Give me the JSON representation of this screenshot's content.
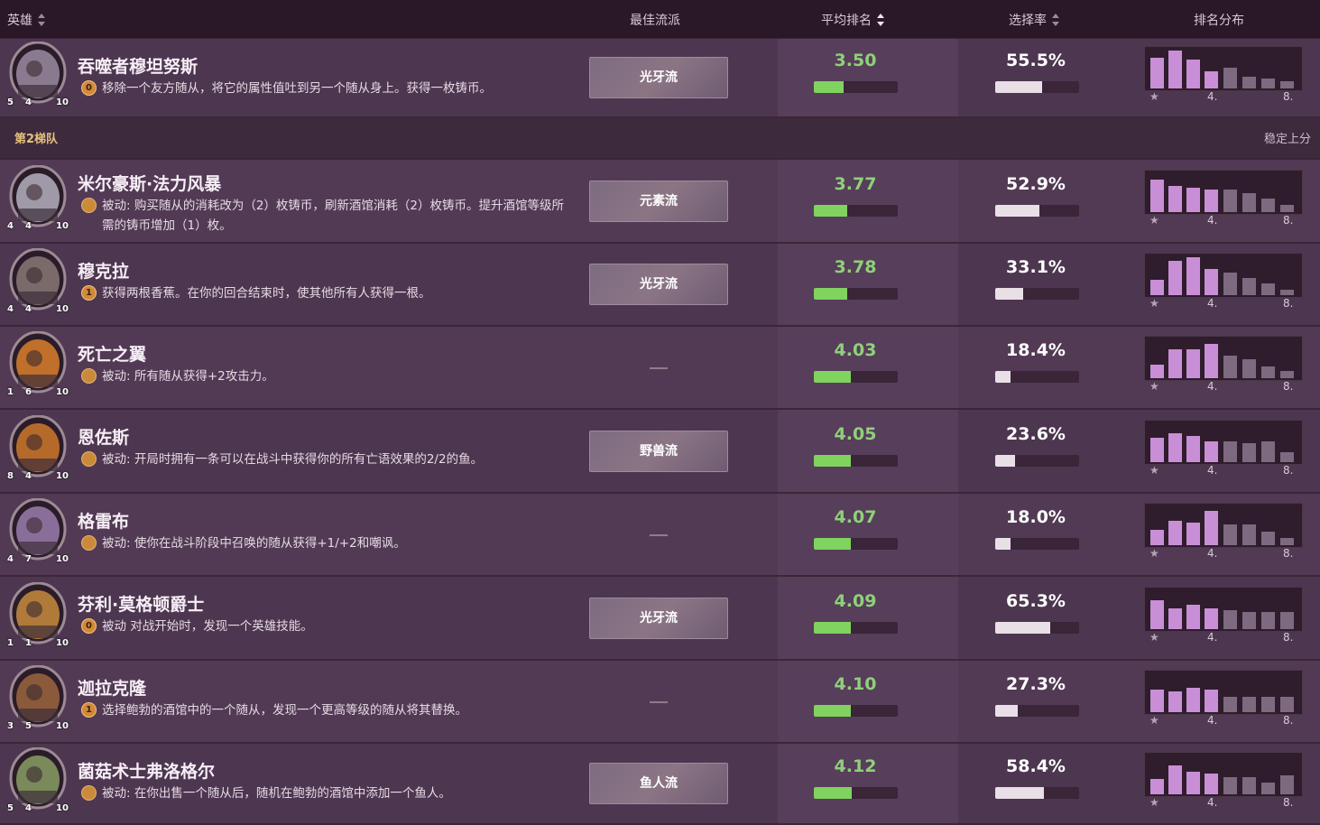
{
  "header": {
    "hero": "英雄",
    "best_comp": "最佳流派",
    "avg_rank": "平均排名",
    "pick_rate": "选择率",
    "distribution": "排名分布"
  },
  "tier2": {
    "label": "第2梯队",
    "note": "稳定上分"
  },
  "dist_labels": {
    "first": "★",
    "mid": "4.",
    "last": "8."
  },
  "colors": {
    "avg_fill": "#7fd35e",
    "pick_fill": "#e8e0e6",
    "dist_top": "#c98fd6",
    "dist_bottom": "#7e6a80"
  },
  "heroes": [
    {
      "name": "吞噬者穆坦努斯",
      "cost": "0",
      "power": "移除一个友方随从，将它的属性值吐到另一个随从身上。获得一枚铸币。",
      "comp": "光牙流",
      "avg": "3.50",
      "avg_pct": 0.35,
      "pick": "55.5%",
      "pick_pct": 0.555,
      "atk": "5",
      "hp": "4",
      "armor": "10",
      "dist": [
        0.8,
        1.0,
        0.75,
        0.45,
        0.55,
        0.3,
        0.25,
        0.2
      ]
    },
    {
      "name": "米尔豪斯·法力风暴",
      "cost": "",
      "power": "被动: 购买随从的消耗改为（2）枚铸币，刷新酒馆消耗（2）枚铸币。提升酒馆等级所需的铸币增加（1）枚。",
      "comp": "元素流",
      "avg": "3.77",
      "avg_pct": 0.4,
      "pick": "52.9%",
      "pick_pct": 0.529,
      "atk": "4",
      "hp": "4",
      "armor": "10",
      "dist": [
        0.85,
        0.7,
        0.65,
        0.6,
        0.6,
        0.5,
        0.35,
        0.2
      ]
    },
    {
      "name": "穆克拉",
      "cost": "1",
      "power": "获得两根香蕉。在你的回合结束时，使其他所有人获得一根。",
      "comp": "光牙流",
      "avg": "3.78",
      "avg_pct": 0.4,
      "pick": "33.1%",
      "pick_pct": 0.331,
      "atk": "4",
      "hp": "4",
      "armor": "10",
      "dist": [
        0.4,
        0.9,
        1.0,
        0.7,
        0.6,
        0.45,
        0.3,
        0.15
      ]
    },
    {
      "name": "死亡之翼",
      "cost": "",
      "power": "被动: 所有随从获得+2攻击力。",
      "comp": "",
      "avg": "4.03",
      "avg_pct": 0.44,
      "pick": "18.4%",
      "pick_pct": 0.184,
      "atk": "1",
      "hp": "6",
      "armor": "10",
      "dist": [
        0.35,
        0.75,
        0.75,
        0.9,
        0.6,
        0.5,
        0.3,
        0.2
      ]
    },
    {
      "name": "恩佐斯",
      "cost": "",
      "power": "被动: 开局时拥有一条可以在战斗中获得你的所有亡语效果的2/2的鱼。",
      "comp": "野兽流",
      "avg": "4.05",
      "avg_pct": 0.44,
      "pick": "23.6%",
      "pick_pct": 0.236,
      "atk": "8",
      "hp": "4",
      "armor": "10",
      "dist": [
        0.65,
        0.75,
        0.7,
        0.55,
        0.55,
        0.5,
        0.55,
        0.25
      ]
    },
    {
      "name": "格雷布",
      "cost": "",
      "power": "被动: 使你在战斗阶段中召唤的随从获得+1/+2和嘲讽。",
      "comp": "",
      "avg": "4.07",
      "avg_pct": 0.44,
      "pick": "18.0%",
      "pick_pct": 0.18,
      "atk": "4",
      "hp": "7",
      "armor": "10",
      "dist": [
        0.4,
        0.65,
        0.6,
        0.9,
        0.55,
        0.55,
        0.35,
        0.2
      ]
    },
    {
      "name": "芬利·莫格顿爵士",
      "cost": "0",
      "power": "被动 对战开始时，发现一个英雄技能。",
      "comp": "光牙流",
      "avg": "4.09",
      "avg_pct": 0.44,
      "pick": "65.3%",
      "pick_pct": 0.653,
      "atk": "1",
      "hp": "1",
      "armor": "10",
      "dist": [
        0.75,
        0.55,
        0.65,
        0.55,
        0.5,
        0.45,
        0.45,
        0.45
      ]
    },
    {
      "name": "迦拉克隆",
      "cost": "1",
      "power": "选择鲍勃的酒馆中的一个随从，发现一个更高等级的随从将其替换。",
      "comp": "",
      "avg": "4.10",
      "avg_pct": 0.44,
      "pick": "27.3%",
      "pick_pct": 0.273,
      "atk": "3",
      "hp": "5",
      "armor": "10",
      "dist": [
        0.6,
        0.55,
        0.65,
        0.6,
        0.4,
        0.4,
        0.4,
        0.4
      ]
    },
    {
      "name": "菌菇术士弗洛格尔",
      "cost": "",
      "power": "被动: 在你出售一个随从后，随机在鲍勃的酒馆中添加一个鱼人。",
      "comp": "鱼人流",
      "avg": "4.12",
      "avg_pct": 0.45,
      "pick": "58.4%",
      "pick_pct": 0.584,
      "atk": "5",
      "hp": "4",
      "armor": "10",
      "dist": [
        0.4,
        0.75,
        0.6,
        0.55,
        0.45,
        0.45,
        0.3,
        0.5
      ]
    }
  ]
}
